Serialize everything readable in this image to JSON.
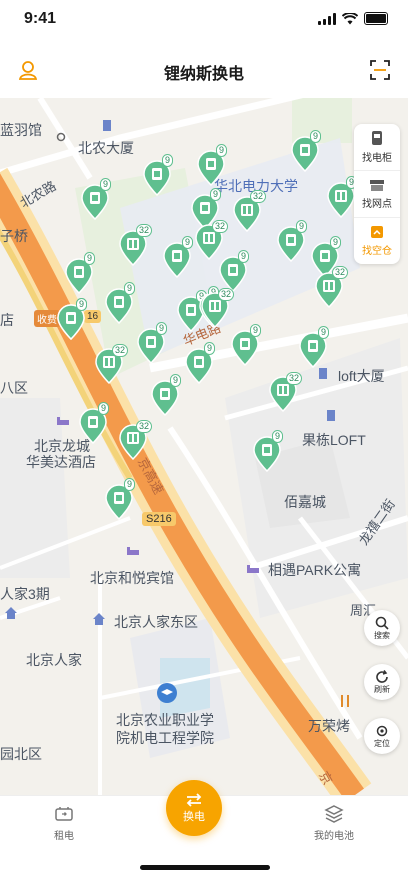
{
  "status": {
    "time": "9:41"
  },
  "nav": {
    "title": "锂纳斯换电",
    "user_icon": "user-icon",
    "scan_icon": "scan-icon"
  },
  "map_labels": {
    "l1": "蓝羽馆",
    "l2": "北农大厦",
    "l3": "北农路",
    "l4": "华北电力大学",
    "l5": "子桥",
    "l6": "店",
    "l7": "八区",
    "l8": "北京龙城",
    "l9": "华美达酒店",
    "l10": "人家3期",
    "l11": "北京和悦宾馆",
    "l12": "北京人家东区",
    "l13": "北京人家",
    "l14": "北京农业职业学",
    "l15": "院机电工程学院",
    "l16": "园北区",
    "l17": "loft大厦",
    "l18": "果栋LOFT",
    "l19": "佰嘉城",
    "l20": "相遇PARK公寓",
    "l21": "万荣烤",
    "l22": "龙禧二街",
    "l23": "周汇",
    "l24": "华电路",
    "l25": "京高速",
    "l26": "收费",
    "l27": "16",
    "l28": "S216",
    "l29": "京"
  },
  "pins": {
    "p1": "9",
    "p2": "9",
    "p3": "9",
    "p4": "9",
    "p5": "9",
    "p6": "32",
    "p7": "9",
    "p8": "32",
    "p9": "9",
    "p10": "32",
    "p11": "9",
    "p12": "9",
    "p13": "9",
    "p14": "9",
    "p15": "9",
    "p16": "32",
    "p17": "9",
    "p18": "9",
    "p19": "9",
    "p20": "32",
    "p21": "9",
    "p22": "9",
    "p23": "9",
    "p24": "9",
    "p25": "32",
    "p26": "9",
    "p27": "32",
    "p28": "9",
    "p29": "9",
    "p30": "32",
    "p31": "9",
    "p32": "9"
  },
  "tools": {
    "cabinet": "找电柜",
    "outlet": "找网点",
    "warehouse": "找空仓"
  },
  "map_buttons": {
    "search": "搜索",
    "refresh": "刷新",
    "locate": "定位"
  },
  "tabs": {
    "rent": "租电",
    "swap": "换电",
    "battery": "我的电池"
  },
  "colors": {
    "accent": "#f7a400",
    "pin": "#5fbf8f",
    "highway": "#f39a4b"
  }
}
